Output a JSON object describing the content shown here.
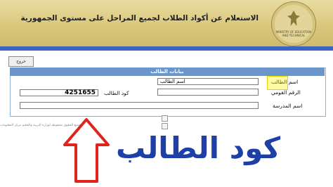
{
  "banner": {
    "title": "الاستعلام عن أكواد الطلاب لجميع المراحل على مستوى الجمهورية"
  },
  "logo": {
    "ring_text": "MINISTRY OF EDUCATION AND TECHNICAL"
  },
  "toolbar": {
    "logout_label": "خروج"
  },
  "panel": {
    "title": "بيانات الطالب"
  },
  "fields": {
    "student_name_label": "اسم الطالب",
    "student_name_value": "اسم الطالب",
    "national_id_label": "الرقم القومي",
    "national_id_value": "",
    "school_name_label": "اسم المدرسة",
    "school_name_value": "",
    "student_code_label": "كود الطالب",
    "student_code_value": "4251655"
  },
  "footer": {
    "note": "جميع الحقوق محفوظة لوزارة التربية والتعليم مركز المعلومات"
  },
  "overlay": {
    "caption": "كود الطالب",
    "arrow_color": "#e0241c",
    "caption_color": "#1d3fa6"
  },
  "colors": {
    "banner": "#d9c67a",
    "header_bar": "#3a63c6",
    "panel_header": "#6a96cc"
  }
}
